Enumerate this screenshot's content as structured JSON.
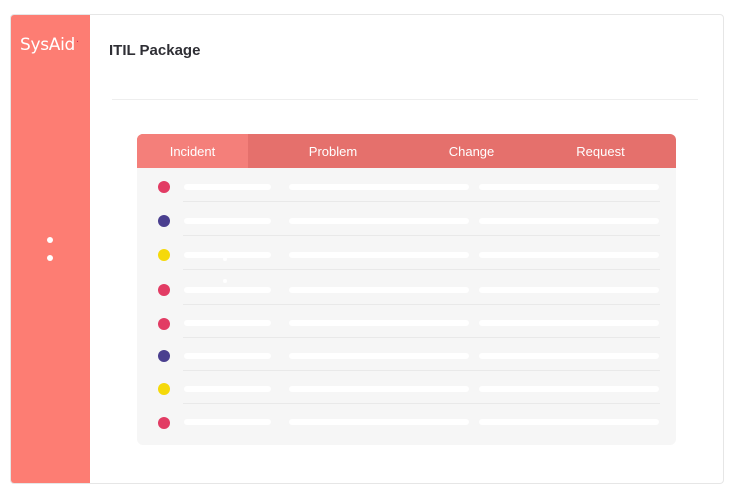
{
  "app": {
    "logo_text": "SysAid",
    "logo_mark": "."
  },
  "header": {
    "title": "ITIL Package"
  },
  "tabs": [
    {
      "label": "Incident",
      "active": true
    },
    {
      "label": "Problem",
      "active": false
    },
    {
      "label": "Change",
      "active": false
    },
    {
      "label": "Request",
      "active": false
    }
  ],
  "rows": [
    {
      "status_color": "#e23c64"
    },
    {
      "status_color": "#4a3f8f"
    },
    {
      "status_color": "#f5d90a"
    },
    {
      "status_color": "#e23c64"
    },
    {
      "status_color": "#e23c64"
    },
    {
      "status_color": "#4a3f8f"
    },
    {
      "status_color": "#f5d90a"
    },
    {
      "status_color": "#e23c64"
    }
  ],
  "colors": {
    "sidebar": "#fd7d73",
    "tab_bar": "#e5706c",
    "tab_active": "#f47f7a",
    "panel": "#f6f6f6"
  },
  "icons": {
    "sidebar_menu": "more-vertical-icon"
  }
}
